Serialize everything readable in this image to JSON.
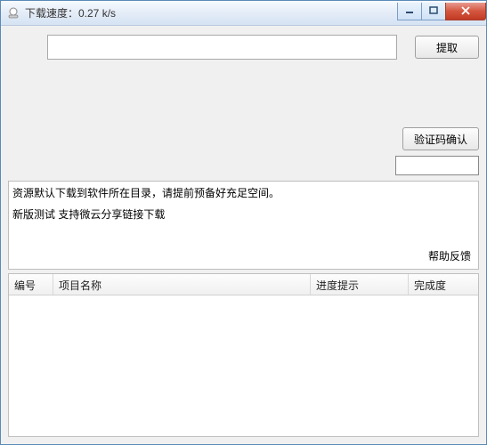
{
  "window": {
    "title": "下载速度：0.27 k/s"
  },
  "toolbar": {
    "extract_label": "提取",
    "verify_label": "验证码确认"
  },
  "inputs": {
    "url_value": "",
    "code_value": ""
  },
  "info": {
    "line1": "资源默认下载到软件所在目录，请提前预备好充足空间。",
    "line2": "新版测试 支持微云分享链接下载",
    "help_label": "帮助反馈"
  },
  "table": {
    "columns": [
      "编号",
      "项目名称",
      "进度提示",
      "完成度"
    ],
    "rows": []
  }
}
